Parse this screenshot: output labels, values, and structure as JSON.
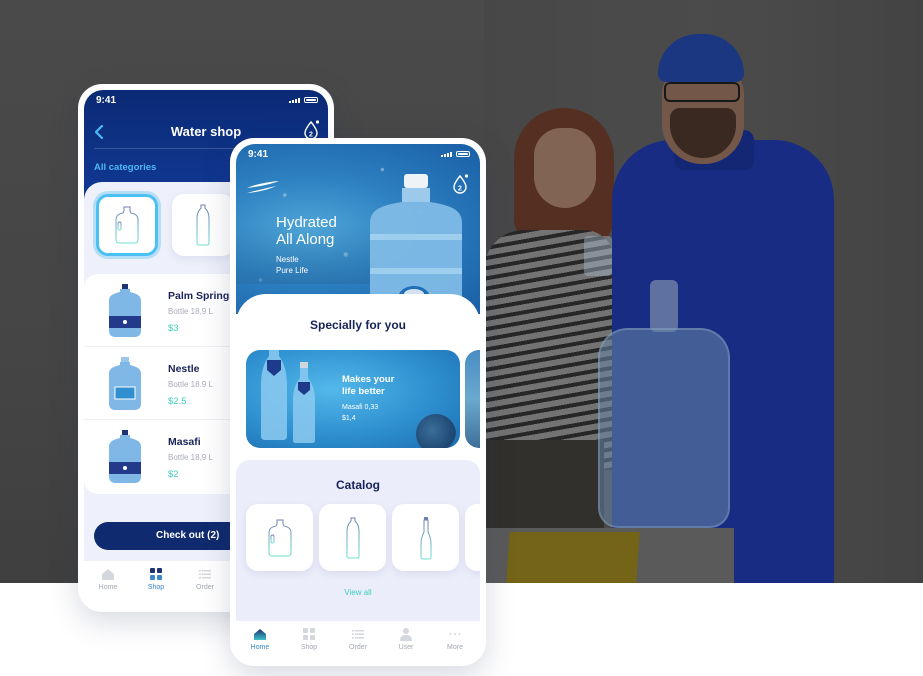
{
  "colors": {
    "brand_navy": "#0f2a6e",
    "accent_cyan": "#4db8f5",
    "price_teal": "#3fcfc0",
    "title_dark": "#18235a"
  },
  "water_shop_screen": {
    "status_time": "9:41",
    "title": "Water shop",
    "back_icon": "chevron-left-icon",
    "cart_icon": "water-drop-badge-icon",
    "cart_count": "2",
    "categories_label": "All categories",
    "category_tiles": [
      {
        "icon": "water-jug-icon",
        "selected": true
      },
      {
        "icon": "plastic-bottle-icon",
        "selected": false
      }
    ],
    "products": [
      {
        "name": "Palm Springs",
        "subtitle": "Bottle 18,9 L",
        "price": "$3"
      },
      {
        "name": "Nestle",
        "subtitle": "Bottle 18.9 L",
        "price": "$2.5"
      },
      {
        "name": "Masafi",
        "subtitle": "Bottle 18,9 L",
        "price": "$2"
      }
    ],
    "checkout_label": "Check out (2)",
    "nav": [
      {
        "label": "Home",
        "icon": "home-icon",
        "active": false
      },
      {
        "label": "Shop",
        "icon": "grid-icon",
        "active": true
      },
      {
        "label": "Order",
        "icon": "list-icon",
        "active": false
      }
    ]
  },
  "home_screen": {
    "status_time": "9:41",
    "logo_icon": "wave-logo-icon",
    "cart_icon": "water-drop-badge-icon",
    "cart_count": "2",
    "hero_title_line1": "Hydrated",
    "hero_title_line2": "All Along",
    "hero_sub_line1": "Nestle",
    "hero_sub_line2": "Pure Life",
    "special_title": "Specially for you",
    "promo": {
      "title_line1": "Makes your",
      "title_line2": "life better",
      "product": "Masafi 0,33",
      "price": "$1,4"
    },
    "catalog_title": "Catalog",
    "catalog_items": [
      {
        "icon": "water-jug-icon"
      },
      {
        "icon": "plastic-bottle-icon"
      },
      {
        "icon": "glass-bottle-icon"
      }
    ],
    "view_all_label": "View all",
    "nav": [
      {
        "label": "Home",
        "icon": "home-icon",
        "active": true
      },
      {
        "label": "Shop",
        "icon": "grid-icon",
        "active": false
      },
      {
        "label": "Order",
        "icon": "list-icon",
        "active": false
      },
      {
        "label": "User",
        "icon": "user-icon",
        "active": false
      },
      {
        "label": "More",
        "icon": "more-dots-icon",
        "active": false
      }
    ]
  }
}
